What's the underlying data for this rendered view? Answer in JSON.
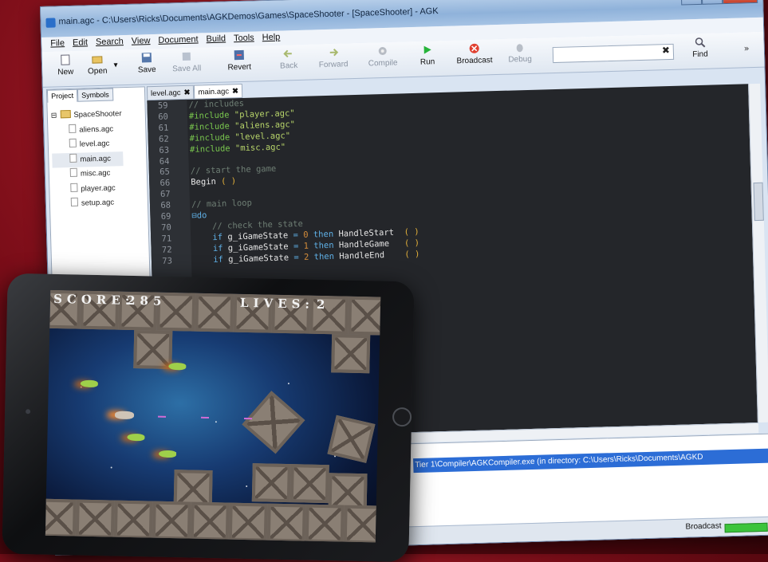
{
  "window": {
    "title": "main.agc - C:\\Users\\Ricks\\Documents\\AGKDemos\\Games\\SpaceShooter - [SpaceShooter] - AGK",
    "min_label": "–",
    "max_label": "□",
    "close_label": "✕"
  },
  "menu": [
    "File",
    "Edit",
    "Search",
    "View",
    "Document",
    "Build",
    "Tools",
    "Help"
  ],
  "toolbar": {
    "new": "New",
    "open": "Open",
    "save": "Save",
    "save_all": "Save All",
    "revert": "Revert",
    "back": "Back",
    "forward": "Forward",
    "compile": "Compile",
    "run": "Run",
    "broadcast": "Broadcast",
    "debug": "Debug",
    "find": "Find",
    "find_clear": "✖",
    "more": "»"
  },
  "panel": {
    "tabs": [
      "Project",
      "Symbols"
    ],
    "project_name": "SpaceShooter",
    "files": [
      "aliens.agc",
      "level.agc",
      "main.agc",
      "misc.agc",
      "player.agc",
      "setup.agc"
    ]
  },
  "editor": {
    "tabs": [
      {
        "label": "level.agc",
        "close": "✖"
      },
      {
        "label": "main.agc",
        "close": "✖"
      }
    ],
    "lines": [
      {
        "n": "59",
        "parts": [
          [
            "cm",
            "// includes"
          ]
        ]
      },
      {
        "n": "60",
        "parts": [
          [
            "pp",
            "#include "
          ],
          [
            "str",
            "\"player.agc\""
          ]
        ]
      },
      {
        "n": "61",
        "parts": [
          [
            "pp",
            "#include "
          ],
          [
            "str",
            "\"aliens.agc\""
          ]
        ]
      },
      {
        "n": "62",
        "parts": [
          [
            "pp",
            "#include "
          ],
          [
            "str",
            "\"level.agc\""
          ]
        ]
      },
      {
        "n": "63",
        "parts": [
          [
            "pp",
            "#include "
          ],
          [
            "str",
            "\"misc.agc\""
          ]
        ]
      },
      {
        "n": "64",
        "parts": []
      },
      {
        "n": "65",
        "parts": [
          [
            "cm",
            "// start the game"
          ]
        ]
      },
      {
        "n": "66",
        "parts": [
          [
            "kw",
            "Begin "
          ],
          [
            "br",
            "( )"
          ]
        ]
      },
      {
        "n": "67",
        "parts": []
      },
      {
        "n": "68",
        "parts": [
          [
            "cm",
            "// main loop"
          ]
        ]
      },
      {
        "n": "69",
        "parts": [
          [
            "kw2",
            "⊟do"
          ]
        ]
      },
      {
        "n": "70",
        "parts": [
          [
            "cm",
            "    // check the state"
          ]
        ]
      },
      {
        "n": "71",
        "parts": [
          [
            "kw2",
            "    if "
          ],
          [
            "txt",
            "g_iGameState "
          ],
          [
            "kw2",
            "= "
          ],
          [
            "num",
            "0 "
          ],
          [
            "kw2",
            "then "
          ],
          [
            "txt",
            "HandleStart  "
          ],
          [
            "br",
            "( )"
          ]
        ]
      },
      {
        "n": "72",
        "parts": [
          [
            "kw2",
            "    if "
          ],
          [
            "txt",
            "g_iGameState "
          ],
          [
            "kw2",
            "= "
          ],
          [
            "num",
            "1 "
          ],
          [
            "kw2",
            "then "
          ],
          [
            "txt",
            "HandleGame   "
          ],
          [
            "br",
            "( )"
          ]
        ]
      },
      {
        "n": "73",
        "parts": [
          [
            "kw2",
            "    if "
          ],
          [
            "txt",
            "g_iGameState "
          ],
          [
            "kw2",
            "= "
          ],
          [
            "num",
            "2 "
          ],
          [
            "kw2",
            "then "
          ],
          [
            "txt",
            "HandleEnd    "
          ],
          [
            "br",
            "( )"
          ]
        ]
      }
    ]
  },
  "output": {
    "line": "Tier 1\\Compiler\\AGKCompiler.exe (in directory: C:\\Users\\Ricks\\Documents\\AGKD"
  },
  "status": {
    "label": "Broadcast"
  },
  "game": {
    "score_label": "SCORE:",
    "score": "285",
    "lives_label": "LIVES:",
    "lives": "2"
  }
}
